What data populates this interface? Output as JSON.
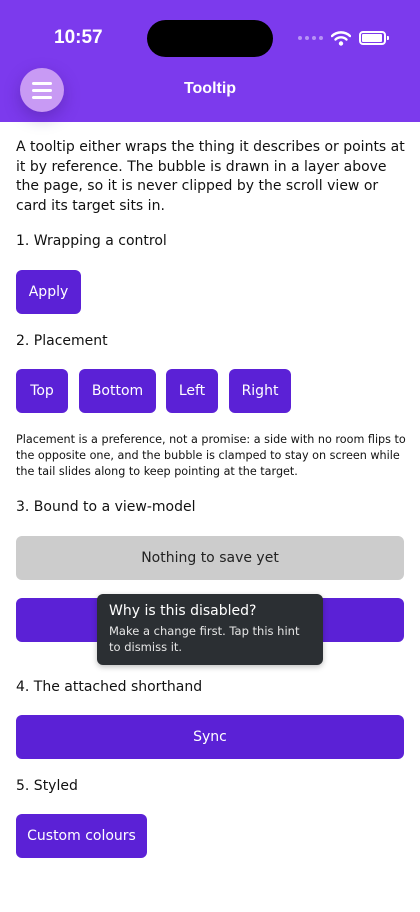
{
  "status_bar": {
    "time": "10:57"
  },
  "header": {
    "title": "Tooltip",
    "menu_icon": "hamburger-menu-icon",
    "background": "#7c3aed"
  },
  "intro": "A tooltip either wraps the thing it describes or points at it by reference. The bubble is drawn in a layer above the page, so it is never clipped by the scroll view or card its target sits in.",
  "sections": {
    "wrapping": {
      "label": "1. Wrapping a control",
      "button": "Apply"
    },
    "placement": {
      "label": "2. Placement",
      "buttons": [
        "Top",
        "Bottom",
        "Left",
        "Right"
      ],
      "note": "Placement is a preference, not a promise: a side with no room flips to the opposite one, and the bubble is clamped to stay on screen while the tail slides along to keep pointing at the target."
    },
    "bound": {
      "label": "3. Bound to a view-model",
      "disabled_button": "Nothing to save yet"
    },
    "shorthand": {
      "label": "4. The attached shorthand",
      "button": "Sync"
    },
    "styled": {
      "label": "5. Styled",
      "button": "Custom colours"
    }
  },
  "tooltip": {
    "title": "Why is this disabled?",
    "body": "Make a change first. Tap this hint to dismiss it."
  },
  "colors": {
    "accent": "#5b21d6",
    "disabled": "#cccccc",
    "tooltip_bg": "#2b2f33"
  }
}
